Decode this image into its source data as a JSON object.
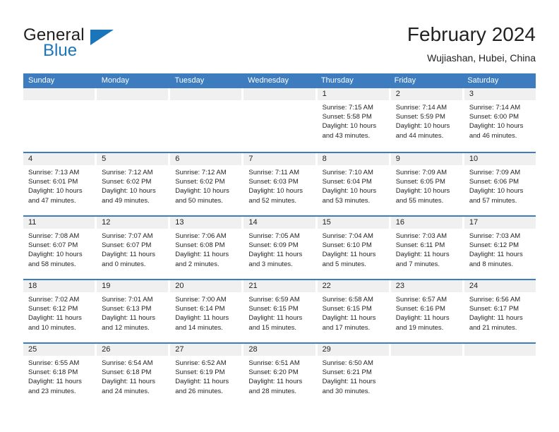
{
  "brand": {
    "name_part1": "General",
    "name_part2": "Blue",
    "triangle_color": "#1b75bb"
  },
  "header": {
    "title": "February 2024",
    "subtitle": "Wujiashan, Hubei, China",
    "accent_color": "#3c7cbf"
  },
  "weekdays": [
    "Sunday",
    "Monday",
    "Tuesday",
    "Wednesday",
    "Thursday",
    "Friday",
    "Saturday"
  ],
  "weeks": [
    [
      {
        "day": "",
        "lines": []
      },
      {
        "day": "",
        "lines": []
      },
      {
        "day": "",
        "lines": []
      },
      {
        "day": "",
        "lines": []
      },
      {
        "day": "1",
        "lines": [
          "Sunrise: 7:15 AM",
          "Sunset: 5:58 PM",
          "Daylight: 10 hours",
          "and 43 minutes."
        ]
      },
      {
        "day": "2",
        "lines": [
          "Sunrise: 7:14 AM",
          "Sunset: 5:59 PM",
          "Daylight: 10 hours",
          "and 44 minutes."
        ]
      },
      {
        "day": "3",
        "lines": [
          "Sunrise: 7:14 AM",
          "Sunset: 6:00 PM",
          "Daylight: 10 hours",
          "and 46 minutes."
        ]
      }
    ],
    [
      {
        "day": "4",
        "lines": [
          "Sunrise: 7:13 AM",
          "Sunset: 6:01 PM",
          "Daylight: 10 hours",
          "and 47 minutes."
        ]
      },
      {
        "day": "5",
        "lines": [
          "Sunrise: 7:12 AM",
          "Sunset: 6:02 PM",
          "Daylight: 10 hours",
          "and 49 minutes."
        ]
      },
      {
        "day": "6",
        "lines": [
          "Sunrise: 7:12 AM",
          "Sunset: 6:02 PM",
          "Daylight: 10 hours",
          "and 50 minutes."
        ]
      },
      {
        "day": "7",
        "lines": [
          "Sunrise: 7:11 AM",
          "Sunset: 6:03 PM",
          "Daylight: 10 hours",
          "and 52 minutes."
        ]
      },
      {
        "day": "8",
        "lines": [
          "Sunrise: 7:10 AM",
          "Sunset: 6:04 PM",
          "Daylight: 10 hours",
          "and 53 minutes."
        ]
      },
      {
        "day": "9",
        "lines": [
          "Sunrise: 7:09 AM",
          "Sunset: 6:05 PM",
          "Daylight: 10 hours",
          "and 55 minutes."
        ]
      },
      {
        "day": "10",
        "lines": [
          "Sunrise: 7:09 AM",
          "Sunset: 6:06 PM",
          "Daylight: 10 hours",
          "and 57 minutes."
        ]
      }
    ],
    [
      {
        "day": "11",
        "lines": [
          "Sunrise: 7:08 AM",
          "Sunset: 6:07 PM",
          "Daylight: 10 hours",
          "and 58 minutes."
        ]
      },
      {
        "day": "12",
        "lines": [
          "Sunrise: 7:07 AM",
          "Sunset: 6:07 PM",
          "Daylight: 11 hours",
          "and 0 minutes."
        ]
      },
      {
        "day": "13",
        "lines": [
          "Sunrise: 7:06 AM",
          "Sunset: 6:08 PM",
          "Daylight: 11 hours",
          "and 2 minutes."
        ]
      },
      {
        "day": "14",
        "lines": [
          "Sunrise: 7:05 AM",
          "Sunset: 6:09 PM",
          "Daylight: 11 hours",
          "and 3 minutes."
        ]
      },
      {
        "day": "15",
        "lines": [
          "Sunrise: 7:04 AM",
          "Sunset: 6:10 PM",
          "Daylight: 11 hours",
          "and 5 minutes."
        ]
      },
      {
        "day": "16",
        "lines": [
          "Sunrise: 7:03 AM",
          "Sunset: 6:11 PM",
          "Daylight: 11 hours",
          "and 7 minutes."
        ]
      },
      {
        "day": "17",
        "lines": [
          "Sunrise: 7:03 AM",
          "Sunset: 6:12 PM",
          "Daylight: 11 hours",
          "and 8 minutes."
        ]
      }
    ],
    [
      {
        "day": "18",
        "lines": [
          "Sunrise: 7:02 AM",
          "Sunset: 6:12 PM",
          "Daylight: 11 hours",
          "and 10 minutes."
        ]
      },
      {
        "day": "19",
        "lines": [
          "Sunrise: 7:01 AM",
          "Sunset: 6:13 PM",
          "Daylight: 11 hours",
          "and 12 minutes."
        ]
      },
      {
        "day": "20",
        "lines": [
          "Sunrise: 7:00 AM",
          "Sunset: 6:14 PM",
          "Daylight: 11 hours",
          "and 14 minutes."
        ]
      },
      {
        "day": "21",
        "lines": [
          "Sunrise: 6:59 AM",
          "Sunset: 6:15 PM",
          "Daylight: 11 hours",
          "and 15 minutes."
        ]
      },
      {
        "day": "22",
        "lines": [
          "Sunrise: 6:58 AM",
          "Sunset: 6:15 PM",
          "Daylight: 11 hours",
          "and 17 minutes."
        ]
      },
      {
        "day": "23",
        "lines": [
          "Sunrise: 6:57 AM",
          "Sunset: 6:16 PM",
          "Daylight: 11 hours",
          "and 19 minutes."
        ]
      },
      {
        "day": "24",
        "lines": [
          "Sunrise: 6:56 AM",
          "Sunset: 6:17 PM",
          "Daylight: 11 hours",
          "and 21 minutes."
        ]
      }
    ],
    [
      {
        "day": "25",
        "lines": [
          "Sunrise: 6:55 AM",
          "Sunset: 6:18 PM",
          "Daylight: 11 hours",
          "and 23 minutes."
        ]
      },
      {
        "day": "26",
        "lines": [
          "Sunrise: 6:54 AM",
          "Sunset: 6:18 PM",
          "Daylight: 11 hours",
          "and 24 minutes."
        ]
      },
      {
        "day": "27",
        "lines": [
          "Sunrise: 6:52 AM",
          "Sunset: 6:19 PM",
          "Daylight: 11 hours",
          "and 26 minutes."
        ]
      },
      {
        "day": "28",
        "lines": [
          "Sunrise: 6:51 AM",
          "Sunset: 6:20 PM",
          "Daylight: 11 hours",
          "and 28 minutes."
        ]
      },
      {
        "day": "29",
        "lines": [
          "Sunrise: 6:50 AM",
          "Sunset: 6:21 PM",
          "Daylight: 11 hours",
          "and 30 minutes."
        ]
      },
      {
        "day": "",
        "lines": []
      },
      {
        "day": "",
        "lines": []
      }
    ]
  ]
}
